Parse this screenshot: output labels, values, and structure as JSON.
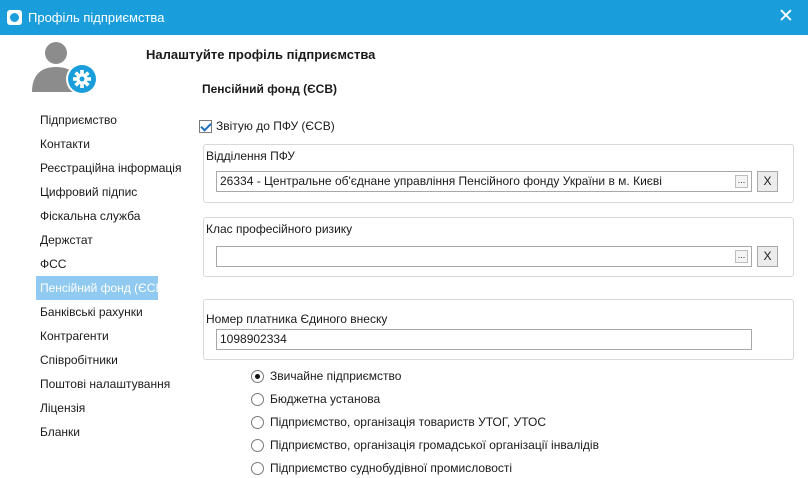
{
  "window": {
    "title": "Профіль підприємства",
    "close_glyph": "✕",
    "icon": "app-logo-icon"
  },
  "header": {
    "avatar_icon": "user-settings-icon",
    "heading": "Налаштуйте профіль підприємства"
  },
  "sidebar": {
    "items": [
      {
        "label": "Підприємство"
      },
      {
        "label": "Контакти"
      },
      {
        "label": "Реєстраційна інформація"
      },
      {
        "label": "Цифровий підпис"
      },
      {
        "label": "Фіскальна служба"
      },
      {
        "label": "Держстат"
      },
      {
        "label": "ФСС"
      },
      {
        "label": "Пенсійний фонд (ЄСВ)",
        "active": true
      },
      {
        "label": "Банківські рахунки"
      },
      {
        "label": "Контрагенти"
      },
      {
        "label": "Співробітники"
      },
      {
        "label": "Поштові налаштування"
      },
      {
        "label": "Ліцензія"
      },
      {
        "label": "Бланки"
      }
    ]
  },
  "main": {
    "section_title": "Пенсійний фонд (ЄСВ)",
    "report_checkbox": {
      "label": "Звітую до ПФУ (ЄСВ)",
      "checked": true
    },
    "pfu_branch": {
      "label": "Відділення ПФУ",
      "value": "26334 - Центральне об'єднане управління Пенсійного фонду України в м. Києві",
      "browse_glyph": "...",
      "clear_glyph": "X"
    },
    "risk_class": {
      "label": "Клас професійного ризику",
      "value": "",
      "browse_glyph": "...",
      "clear_glyph": "X"
    },
    "payer_number": {
      "label": "Номер платника Єдиного внеску",
      "value": "1098902334"
    },
    "enterprise_type": {
      "selected": 0,
      "options": [
        "Звичайне підприємство",
        "Бюджетна установа",
        "Підприємство, організація товариств УТОГ, УТОС",
        "Підприємство, організація громадської організації інвалідів",
        "Підприємство суднобудівної промисловості"
      ]
    }
  },
  "colors": {
    "titlebar": "#1a9edb",
    "sidebar_active": "#90caf0",
    "avatar_gear": "#1a9edb",
    "avatar_person": "#8c8c8c"
  }
}
